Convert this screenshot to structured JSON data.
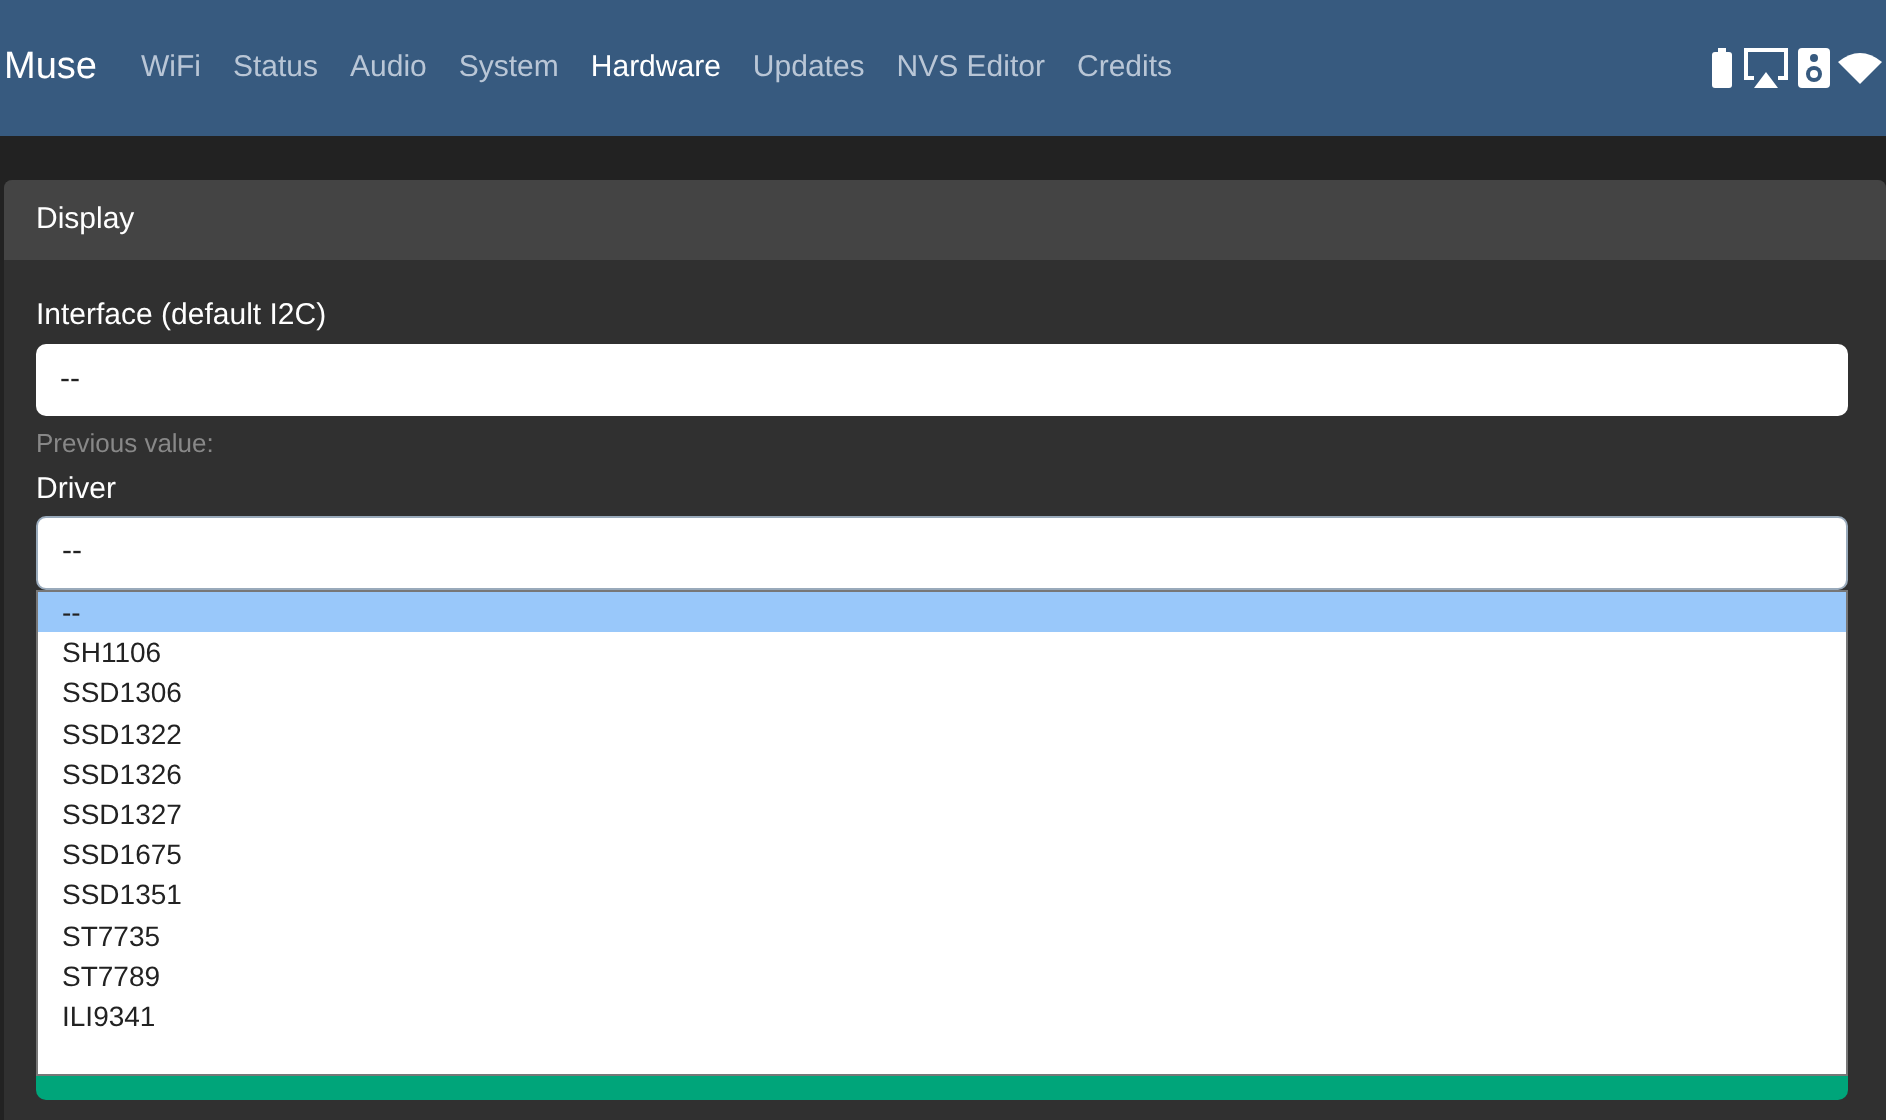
{
  "navbar": {
    "brand": "Muse",
    "links": [
      {
        "label": "WiFi",
        "selected": false
      },
      {
        "label": "Status",
        "selected": false
      },
      {
        "label": "Audio",
        "selected": false
      },
      {
        "label": "System",
        "selected": false
      },
      {
        "label": "Hardware",
        "selected": true
      },
      {
        "label": "Updates",
        "selected": false
      },
      {
        "label": "NVS Editor",
        "selected": false
      },
      {
        "label": "Credits",
        "selected": false
      }
    ]
  },
  "card": {
    "title": "Display",
    "interface": {
      "label": "Interface (default I2C)",
      "value": "--",
      "hint": "Previous value:"
    },
    "driver": {
      "label": "Driver",
      "value": "--",
      "options": [
        {
          "label": "--",
          "selected": true
        },
        {
          "label": "SH1106",
          "selected": false
        },
        {
          "label": "SSD1306",
          "selected": false
        },
        {
          "label": "SSD1322",
          "selected": false
        },
        {
          "label": "SSD1326",
          "selected": false
        },
        {
          "label": "SSD1327",
          "selected": false
        },
        {
          "label": "SSD1675",
          "selected": false
        },
        {
          "label": "SSD1351",
          "selected": false
        },
        {
          "label": "ST7735",
          "selected": false
        },
        {
          "label": "ST7789",
          "selected": false
        },
        {
          "label": "ILI9341",
          "selected": false
        }
      ]
    }
  }
}
